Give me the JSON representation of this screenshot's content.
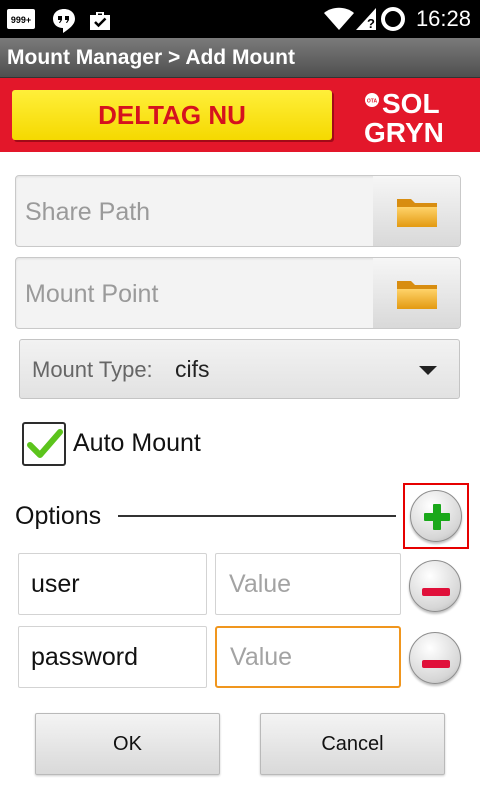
{
  "status_bar": {
    "time": "16:28",
    "left_icons": [
      "notification-999-icon",
      "hangouts-icon",
      "briefcase-check-icon"
    ],
    "right_icons": [
      "wifi-icon",
      "signal-icon",
      "battery-ring-icon"
    ],
    "badge_text": "999+"
  },
  "title_bar": {
    "title": "Mount Manager > Add Mount"
  },
  "ad_banner": {
    "cta_label": "DELTAG NU",
    "logo_text_top": "SOL",
    "logo_text_bottom": "GRYN",
    "logo_badge": "OTA",
    "background_color": "#e3172a",
    "cta_color": "#ffe81c"
  },
  "form": {
    "share_path": {
      "value": "",
      "placeholder": "Share Path"
    },
    "mount_point": {
      "value": "",
      "placeholder": "Mount Point"
    },
    "mount_type": {
      "label": "Mount Type:",
      "value": "cifs"
    },
    "auto_mount": {
      "label": "Auto Mount",
      "checked": true
    }
  },
  "options": {
    "label": "Options",
    "rows": [
      {
        "key": "user",
        "value": "",
        "value_placeholder": "Value"
      },
      {
        "key": "password",
        "value": "",
        "value_placeholder": "Value"
      }
    ]
  },
  "buttons": {
    "ok": "OK",
    "cancel": "Cancel"
  },
  "colors": {
    "focus_orange": "#f0961e",
    "add_green": "#1aa81a",
    "remove_red": "#e0103a",
    "highlight_border": "#e60000"
  }
}
